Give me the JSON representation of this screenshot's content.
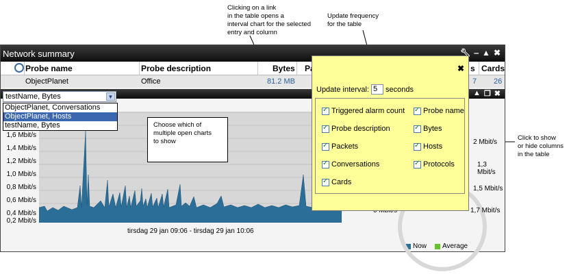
{
  "annotations": {
    "link_note": "Clicking on a link\nin the table opens a\ninterval chart for the selected\nentry and column",
    "freq_note": "Update frequency\nfor the table",
    "charts_note": "Choose which of\nmultiple open charts\nto show",
    "columns_note": "Click to show\nor hide columns\nin the table"
  },
  "window": {
    "title": "Network summary",
    "controls": [
      "wrench-icon",
      "minimize-icon",
      "maximize-icon",
      "close-icon"
    ]
  },
  "table": {
    "headers": [
      "Probe name",
      "Probe description",
      "Bytes",
      "Pa",
      "s",
      "Cards"
    ],
    "row": {
      "probe_name": "ObjectPlanet",
      "probe_description": "Office",
      "bytes": "81.2 MB",
      "col5": "7",
      "cards": "26"
    }
  },
  "chart_selector": {
    "selected": "testName, Bytes",
    "options": [
      "ObjectPlanet, Conversations",
      "ObjectPlanet, Hosts",
      "testName, Bytes"
    ],
    "highlighted_index": 1
  },
  "chart": {
    "y_ticks": [
      "1,6 Mbit/s",
      "1,4 Mbit/s",
      "1,2 Mbit/s",
      "1,0 Mbit/s",
      "0,8 Mbit/s",
      "0,6 Mbit/s",
      "0,4 Mbit/s",
      "0,2 Mbit/s",
      "0 Mbit/s"
    ],
    "x_label": "tirsdag 29 jan 09:06 - tirsdag 29 jan 10:06",
    "legend": [
      {
        "label": "Now",
        "color": "#2b6e98"
      },
      {
        "label": "Average",
        "color": "#66c22a"
      }
    ]
  },
  "right_labels": [
    "2 Mbit/s",
    "1,3 Mbit/s",
    "1,5 Mbit/s",
    "1,7 Mbit/s",
    "0 Mbit/s"
  ],
  "settings_popup": {
    "interval_label": "Update interval:",
    "interval_value": "5",
    "interval_unit": "seconds",
    "columns": [
      {
        "label": "Triggered alarm count",
        "checked": true
      },
      {
        "label": "Probe name",
        "checked": true
      },
      {
        "label": "Probe description",
        "checked": true
      },
      {
        "label": "Bytes",
        "checked": true
      },
      {
        "label": "Packets",
        "checked": true
      },
      {
        "label": "Hosts",
        "checked": true
      },
      {
        "label": "Conversations",
        "checked": true
      },
      {
        "label": "Protocols",
        "checked": true
      },
      {
        "label": "Cards",
        "checked": true
      }
    ]
  }
}
